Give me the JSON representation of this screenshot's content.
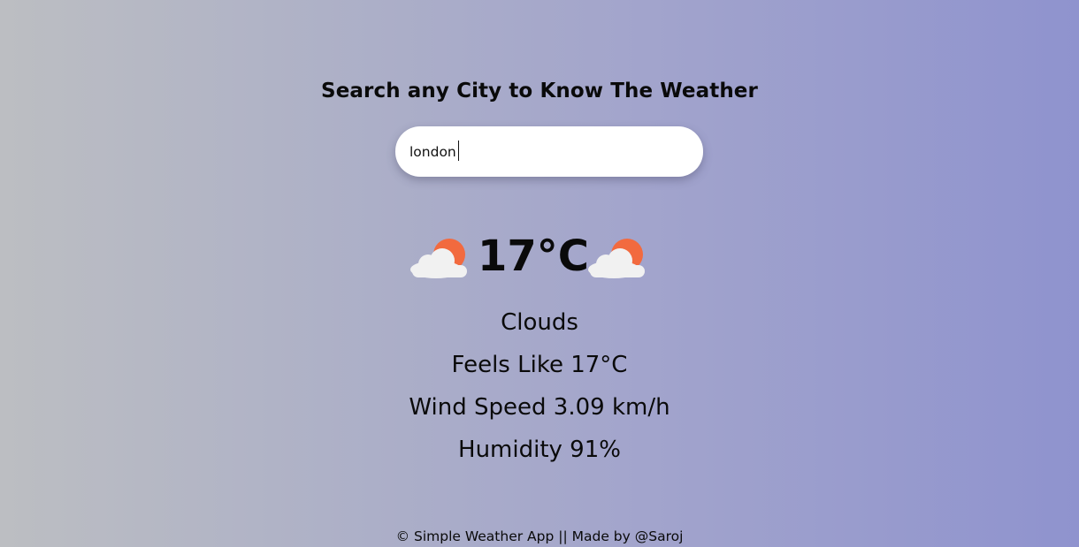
{
  "header": {
    "title": "Search any City to Know The Weather"
  },
  "search": {
    "value": "london",
    "placeholder": ""
  },
  "weather": {
    "icon": "cloud-sun-icon",
    "temperature": "17°C",
    "description": "Clouds",
    "feels_like": "Feels Like 17°C",
    "wind_speed": "Wind Speed 3.09 km/h",
    "humidity": "Humidity 91%"
  },
  "footer": {
    "text": "© Simple Weather App || Made by @Saroj"
  },
  "colors": {
    "sun": "#f26a3f",
    "cloud": "#f1f1f1",
    "gradient_start": "#bcbec2",
    "gradient_end": "#8f93ce"
  }
}
